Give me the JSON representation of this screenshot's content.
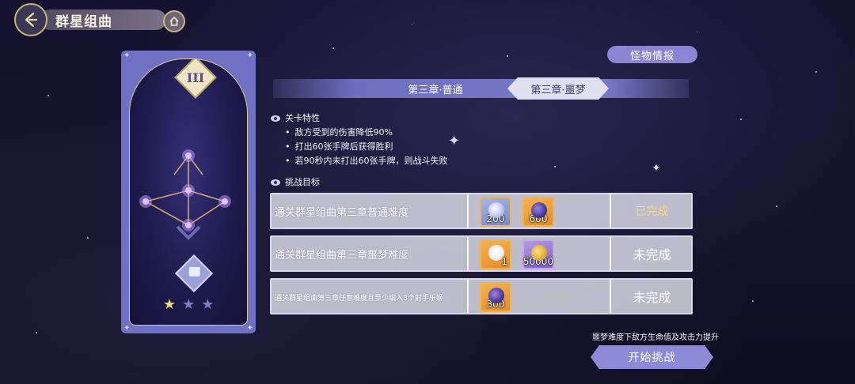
{
  "header": {
    "title": "群星组曲"
  },
  "card": {
    "chapter_numeral": "III",
    "stars_earned": 1,
    "stars_total": 3
  },
  "monster_info": {
    "label": "怪物情报"
  },
  "tabs": [
    {
      "label": "第三章·普通",
      "selected": false
    },
    {
      "label": "第三章·噩梦",
      "selected": true
    }
  ],
  "stage_features": {
    "title": "关卡特性",
    "items": [
      "敌方受到的伤害降低90%",
      "打出60张手牌后获得胜利",
      "若90秒内未打出60张手牌，则战斗失败"
    ]
  },
  "challenge": {
    "title": "挑战目标",
    "rows": [
      {
        "desc": "通关群星组曲第三章普通难度",
        "rewards": [
          {
            "icon": "crystal-gem-icon",
            "count": "200",
            "frame": "blue"
          },
          {
            "icon": "dark-orb-icon",
            "count": "600",
            "frame": "gold"
          }
        ],
        "status": "已完成"
      },
      {
        "desc": "通关群星组曲第三章噩梦难度",
        "rewards": [
          {
            "icon": "character-portrait-icon",
            "count": "1",
            "frame": "gold"
          },
          {
            "icon": "gold-coin-icon",
            "count": "50000",
            "frame": "purple"
          }
        ],
        "status": "未完成"
      },
      {
        "desc": "通关群星组曲第三章任意难度且至少编入3个射手乐姬",
        "rewards": [
          {
            "icon": "dark-orb-icon",
            "count": "300",
            "frame": "gold"
          }
        ],
        "status": "未完成"
      }
    ]
  },
  "footer": {
    "note": "噩梦难度下敌方生命值及攻击力提升",
    "start_label": "开始挑战"
  }
}
